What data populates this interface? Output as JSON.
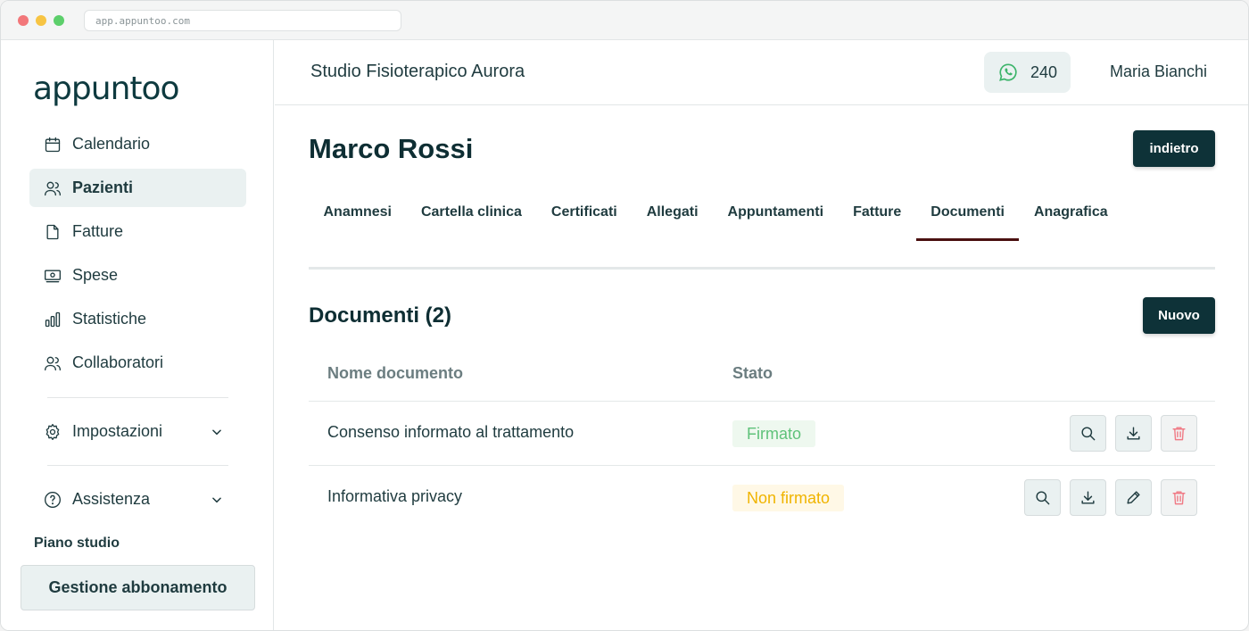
{
  "browser": {
    "url": "app.appuntoo.com"
  },
  "sidebar": {
    "logo": "appuntoo",
    "items": [
      {
        "label": "Calendario",
        "icon": "calendar-icon"
      },
      {
        "label": "Pazienti",
        "icon": "users-icon",
        "active": true
      },
      {
        "label": "Fatture",
        "icon": "file-icon"
      },
      {
        "label": "Spese",
        "icon": "money-icon"
      },
      {
        "label": "Statistiche",
        "icon": "bar-chart-icon"
      },
      {
        "label": "Collaboratori",
        "icon": "users-icon"
      }
    ],
    "settings": {
      "label": "Impostazioni",
      "icon": "gear-icon"
    },
    "help": {
      "label": "Assistenza",
      "icon": "question-icon"
    },
    "plan_title": "Piano studio",
    "plan_button": "Gestione abbonamento"
  },
  "header": {
    "studio_name": "Studio Fisioterapico Aurora",
    "whatsapp_count": "240",
    "user_name": "Maria Bianchi"
  },
  "patient": {
    "name": "Marco Rossi",
    "back_label": "indietro"
  },
  "tabs": [
    {
      "label": "Anamnesi"
    },
    {
      "label": "Cartella clinica"
    },
    {
      "label": "Certificati"
    },
    {
      "label": "Allegati"
    },
    {
      "label": "Appuntamenti"
    },
    {
      "label": "Fatture"
    },
    {
      "label": "Documenti",
      "active": true
    },
    {
      "label": "Anagrafica"
    }
  ],
  "documents": {
    "title": "Documenti (2)",
    "new_label": "Nuovo",
    "columns": {
      "name": "Nome documento",
      "status": "Stato"
    },
    "rows": [
      {
        "name": "Consenso informato al trattamento",
        "status": "Firmato",
        "status_color": "#5fc27a",
        "actions": [
          "view",
          "download",
          "delete"
        ]
      },
      {
        "name": "Informativa privacy",
        "status": "Non firmato",
        "status_color": "#f0b400",
        "actions": [
          "view",
          "download",
          "edit",
          "delete"
        ]
      }
    ]
  },
  "colors": {
    "primary": "#0e3238",
    "active_tab": "#4a1010",
    "nav_active_bg": "#eaf1f1",
    "delete": "#f07b86"
  }
}
